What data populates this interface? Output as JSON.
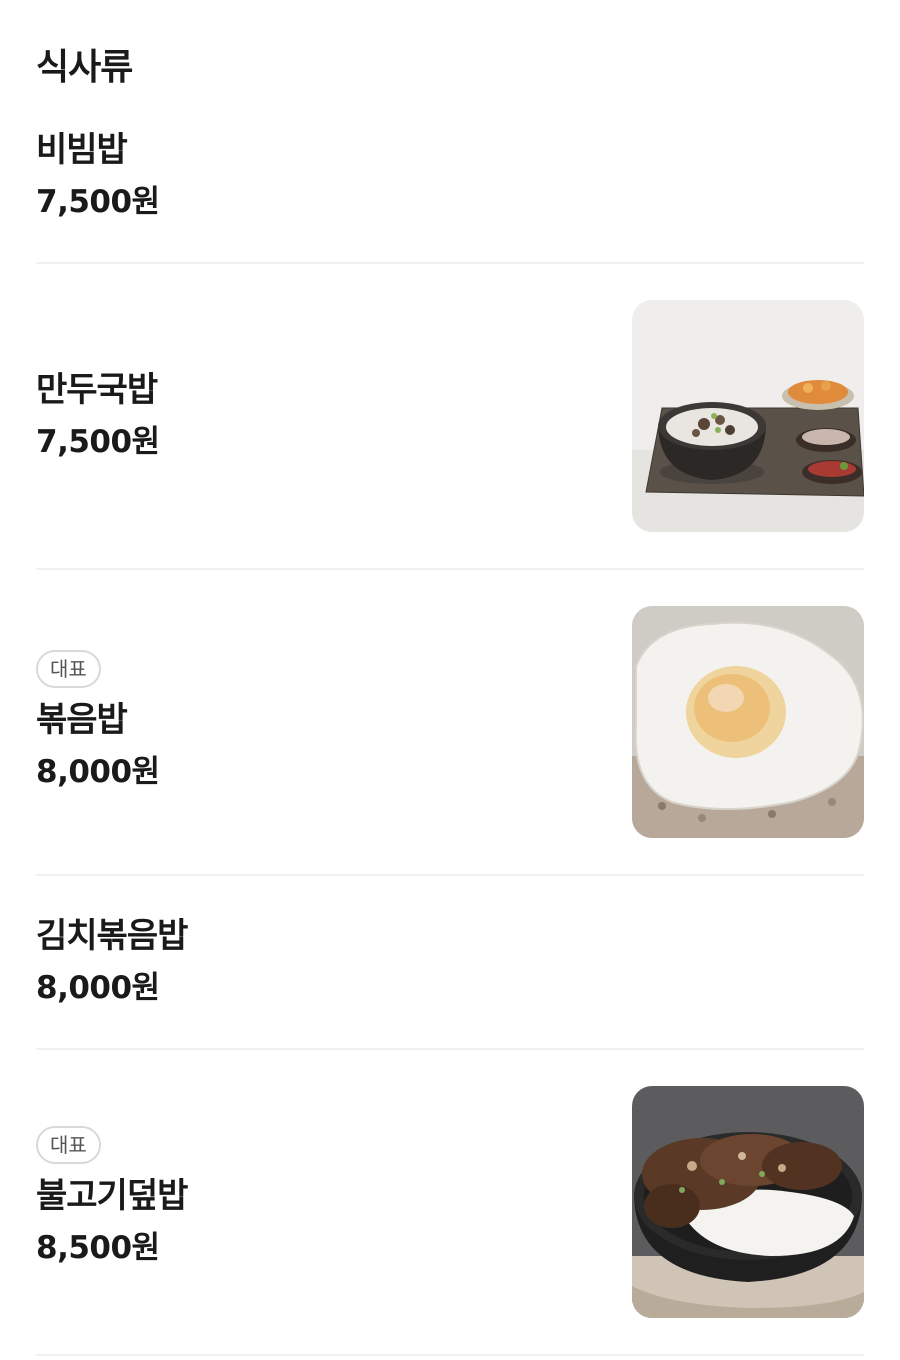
{
  "section": {
    "title": "식사류"
  },
  "items": [
    {
      "name": "비빔밥",
      "price": "7,500원"
    },
    {
      "name": "만두국밥",
      "price": "7,500원",
      "image": "gukbap-photo"
    },
    {
      "name": "볶음밥",
      "price": "8,000원",
      "badge": "대표",
      "image": "fried-rice-photo"
    },
    {
      "name": "김치볶음밥",
      "price": "8,000원"
    },
    {
      "name": "불고기덮밥",
      "price": "8,500원",
      "badge": "대표",
      "image": "bulgogi-rice-photo"
    }
  ]
}
